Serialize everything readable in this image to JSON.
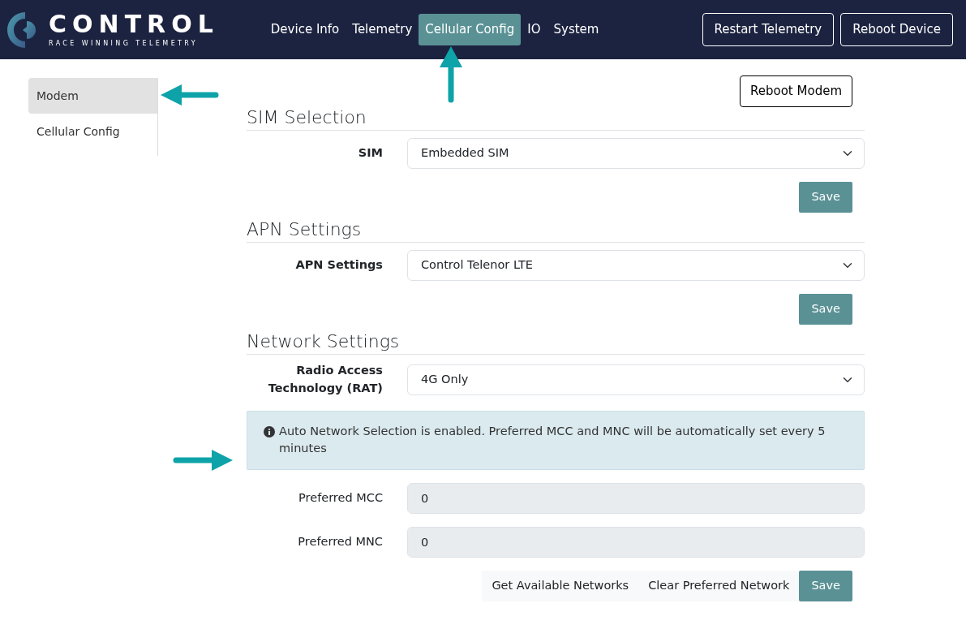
{
  "brand": {
    "name": "CONTROL",
    "tagline": "RACE WINNING TELEMETRY"
  },
  "nav": [
    {
      "label": "Device Info",
      "selected": false
    },
    {
      "label": "Telemetry",
      "selected": false
    },
    {
      "label": "Cellular Config",
      "selected": true
    },
    {
      "label": "IO",
      "selected": false
    },
    {
      "label": "System",
      "selected": false
    }
  ],
  "nav_buttons": [
    "Restart Telemetry",
    "Reboot Device"
  ],
  "sidebar": [
    {
      "label": "Modem",
      "selected": true
    },
    {
      "label": "Cellular Config",
      "selected": false
    }
  ],
  "reboot_modem": "Reboot Modem",
  "sections": [
    {
      "title": "SIM Selection",
      "label": "SIM",
      "value": "Embedded SIM",
      "save": "Save"
    },
    {
      "title": "APN Settings",
      "label": "APN Settings",
      "value": "Control Telenor LTE",
      "save": "Save"
    },
    {
      "title": "Network Settings",
      "label": "Radio Access Technology (RAT)",
      "value": "4G Only"
    }
  ],
  "alert": "Auto Network Selection is enabled. Preferred MCC and MNC will be automatically set every 5 minutes",
  "fields": [
    {
      "label": "Preferred MCC",
      "value": "0",
      "disabled": true
    },
    {
      "label": "Preferred MNC",
      "value": "0",
      "disabled": true
    }
  ],
  "actions": [
    {
      "label": "Get Available Networks",
      "kind": "light"
    },
    {
      "label": "Clear Preferred Network",
      "kind": "light"
    },
    {
      "label": "Save",
      "kind": "primary"
    }
  ]
}
